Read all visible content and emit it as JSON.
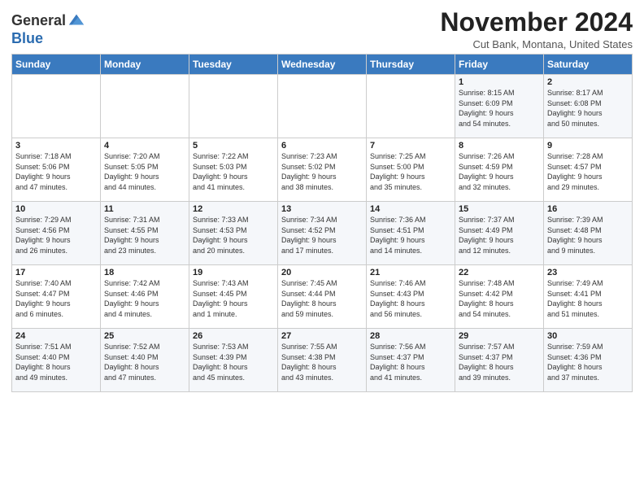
{
  "header": {
    "logo_line1": "General",
    "logo_line2": "Blue",
    "month": "November 2024",
    "location": "Cut Bank, Montana, United States"
  },
  "weekdays": [
    "Sunday",
    "Monday",
    "Tuesday",
    "Wednesday",
    "Thursday",
    "Friday",
    "Saturday"
  ],
  "weeks": [
    [
      {
        "day": "",
        "info": ""
      },
      {
        "day": "",
        "info": ""
      },
      {
        "day": "",
        "info": ""
      },
      {
        "day": "",
        "info": ""
      },
      {
        "day": "",
        "info": ""
      },
      {
        "day": "1",
        "info": "Sunrise: 8:15 AM\nSunset: 6:09 PM\nDaylight: 9 hours\nand 54 minutes."
      },
      {
        "day": "2",
        "info": "Sunrise: 8:17 AM\nSunset: 6:08 PM\nDaylight: 9 hours\nand 50 minutes."
      }
    ],
    [
      {
        "day": "3",
        "info": "Sunrise: 7:18 AM\nSunset: 5:06 PM\nDaylight: 9 hours\nand 47 minutes."
      },
      {
        "day": "4",
        "info": "Sunrise: 7:20 AM\nSunset: 5:05 PM\nDaylight: 9 hours\nand 44 minutes."
      },
      {
        "day": "5",
        "info": "Sunrise: 7:22 AM\nSunset: 5:03 PM\nDaylight: 9 hours\nand 41 minutes."
      },
      {
        "day": "6",
        "info": "Sunrise: 7:23 AM\nSunset: 5:02 PM\nDaylight: 9 hours\nand 38 minutes."
      },
      {
        "day": "7",
        "info": "Sunrise: 7:25 AM\nSunset: 5:00 PM\nDaylight: 9 hours\nand 35 minutes."
      },
      {
        "day": "8",
        "info": "Sunrise: 7:26 AM\nSunset: 4:59 PM\nDaylight: 9 hours\nand 32 minutes."
      },
      {
        "day": "9",
        "info": "Sunrise: 7:28 AM\nSunset: 4:57 PM\nDaylight: 9 hours\nand 29 minutes."
      }
    ],
    [
      {
        "day": "10",
        "info": "Sunrise: 7:29 AM\nSunset: 4:56 PM\nDaylight: 9 hours\nand 26 minutes."
      },
      {
        "day": "11",
        "info": "Sunrise: 7:31 AM\nSunset: 4:55 PM\nDaylight: 9 hours\nand 23 minutes."
      },
      {
        "day": "12",
        "info": "Sunrise: 7:33 AM\nSunset: 4:53 PM\nDaylight: 9 hours\nand 20 minutes."
      },
      {
        "day": "13",
        "info": "Sunrise: 7:34 AM\nSunset: 4:52 PM\nDaylight: 9 hours\nand 17 minutes."
      },
      {
        "day": "14",
        "info": "Sunrise: 7:36 AM\nSunset: 4:51 PM\nDaylight: 9 hours\nand 14 minutes."
      },
      {
        "day": "15",
        "info": "Sunrise: 7:37 AM\nSunset: 4:49 PM\nDaylight: 9 hours\nand 12 minutes."
      },
      {
        "day": "16",
        "info": "Sunrise: 7:39 AM\nSunset: 4:48 PM\nDaylight: 9 hours\nand 9 minutes."
      }
    ],
    [
      {
        "day": "17",
        "info": "Sunrise: 7:40 AM\nSunset: 4:47 PM\nDaylight: 9 hours\nand 6 minutes."
      },
      {
        "day": "18",
        "info": "Sunrise: 7:42 AM\nSunset: 4:46 PM\nDaylight: 9 hours\nand 4 minutes."
      },
      {
        "day": "19",
        "info": "Sunrise: 7:43 AM\nSunset: 4:45 PM\nDaylight: 9 hours\nand 1 minute."
      },
      {
        "day": "20",
        "info": "Sunrise: 7:45 AM\nSunset: 4:44 PM\nDaylight: 8 hours\nand 59 minutes."
      },
      {
        "day": "21",
        "info": "Sunrise: 7:46 AM\nSunset: 4:43 PM\nDaylight: 8 hours\nand 56 minutes."
      },
      {
        "day": "22",
        "info": "Sunrise: 7:48 AM\nSunset: 4:42 PM\nDaylight: 8 hours\nand 54 minutes."
      },
      {
        "day": "23",
        "info": "Sunrise: 7:49 AM\nSunset: 4:41 PM\nDaylight: 8 hours\nand 51 minutes."
      }
    ],
    [
      {
        "day": "24",
        "info": "Sunrise: 7:51 AM\nSunset: 4:40 PM\nDaylight: 8 hours\nand 49 minutes."
      },
      {
        "day": "25",
        "info": "Sunrise: 7:52 AM\nSunset: 4:40 PM\nDaylight: 8 hours\nand 47 minutes."
      },
      {
        "day": "26",
        "info": "Sunrise: 7:53 AM\nSunset: 4:39 PM\nDaylight: 8 hours\nand 45 minutes."
      },
      {
        "day": "27",
        "info": "Sunrise: 7:55 AM\nSunset: 4:38 PM\nDaylight: 8 hours\nand 43 minutes."
      },
      {
        "day": "28",
        "info": "Sunrise: 7:56 AM\nSunset: 4:37 PM\nDaylight: 8 hours\nand 41 minutes."
      },
      {
        "day": "29",
        "info": "Sunrise: 7:57 AM\nSunset: 4:37 PM\nDaylight: 8 hours\nand 39 minutes."
      },
      {
        "day": "30",
        "info": "Sunrise: 7:59 AM\nSunset: 4:36 PM\nDaylight: 8 hours\nand 37 minutes."
      }
    ]
  ]
}
